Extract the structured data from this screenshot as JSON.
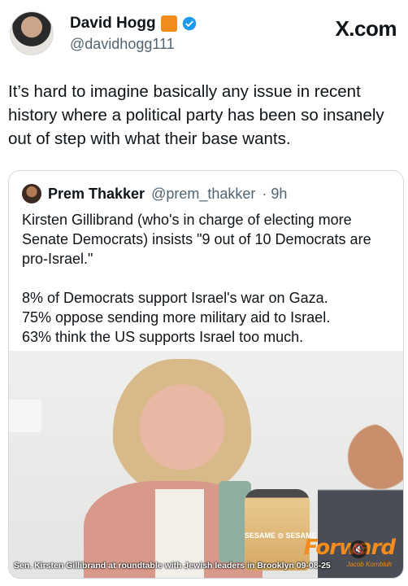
{
  "header": {
    "display_name": "David Hogg",
    "handle": "@davidhogg111",
    "brand": "X.com",
    "emoji": "orange-square",
    "verified_color": "#1d9bf0"
  },
  "tweet": {
    "text": "It’s hard to imagine basically any issue in recent history where a political party has been so insanely out of step with what their base wants."
  },
  "quote": {
    "name": "Prem Thakker",
    "handle": "@prem_thakker",
    "time": "· 9h",
    "paragraph1": "Kirsten Gillibrand (who's in charge of electing more Senate Democrats) insists \"9 out of 10 Democrats are pro-Israel.\"",
    "line1": "8% of Democrats support Israel's war on Gaza.",
    "line2": "75% oppose sending more military aid to Israel.",
    "line3": "63% think the US supports Israel too much."
  },
  "media": {
    "caption": "Sen. Kirsten Gillibrand at roundtable with Jewish leaders in Brooklyn 09-08-25",
    "brand_logo": "Forward",
    "credit": "Jacob Kornbluh",
    "label": "SESAME ⊙ SESAME",
    "icon": "mute-icon"
  }
}
